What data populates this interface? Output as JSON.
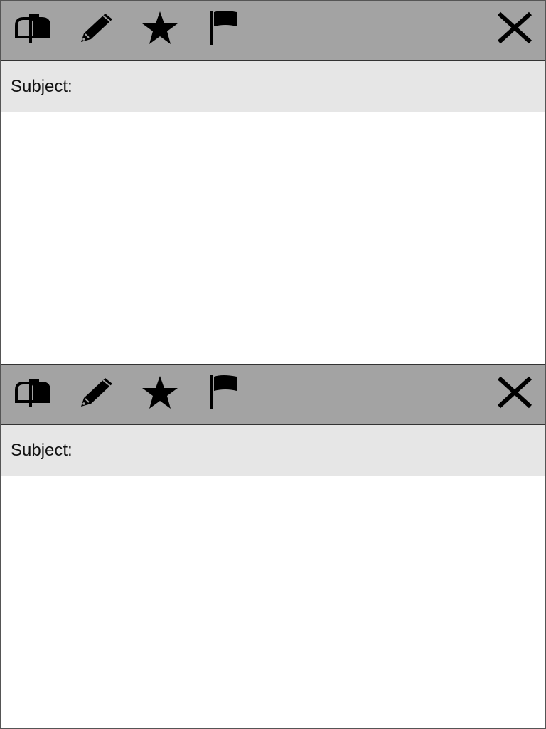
{
  "panels": [
    {
      "toolbar": {
        "icons": [
          "mailbox-icon",
          "pencil-icon",
          "star-icon",
          "flag-icon",
          "close-icon"
        ]
      },
      "subject_label": "Subject:"
    },
    {
      "toolbar": {
        "icons": [
          "mailbox-icon",
          "pencil-icon",
          "star-icon",
          "flag-icon",
          "close-icon"
        ]
      },
      "subject_label": "Subject:"
    }
  ],
  "colors": {
    "toolbar_bg": "#a3a3a3",
    "subject_bg": "#e6e6e6",
    "body_bg": "#ffffff",
    "icon": "#000000"
  }
}
